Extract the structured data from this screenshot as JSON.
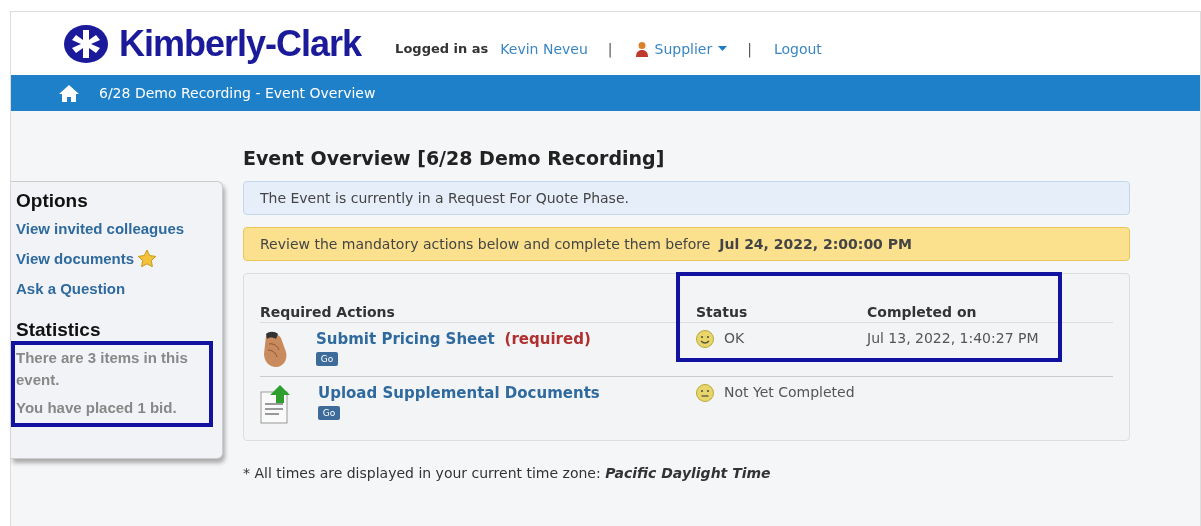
{
  "header": {
    "logo_text": "Kimberly-Clark",
    "logged_in_label": "Logged in as",
    "user": "Kevin Neveu",
    "separator_1": "|",
    "role": "Supplier",
    "separator_2": "|",
    "logout": "Logout"
  },
  "breadcrumb": {
    "text": "6/28 Demo Recording - Event Overview"
  },
  "sidebar": {
    "options_title": "Options",
    "links": [
      {
        "label": "View invited colleagues",
        "kind": "plain"
      },
      {
        "label": "View documents",
        "kind": "starred"
      },
      {
        "label": "Ask a Question",
        "kind": "plain"
      }
    ],
    "statistics_title": "Statistics",
    "statistics": [
      "There are 3 items in this event.",
      "You have placed 1 bid."
    ]
  },
  "title": "Event Overview [6/28 Demo Recording]",
  "phase_notice": "The Event is currently in a Request For Quote Phase.",
  "deadline_notice": {
    "text": "Review the mandatory actions below and complete them before",
    "deadline": "Jul 24, 2022, 2:00:00 PM"
  },
  "table": {
    "columns": [
      "Required Actions",
      "Status",
      "Completed on"
    ],
    "rows": [
      {
        "kind": "pricing",
        "action": "Submit Pricing Sheet",
        "required_label": "(required)",
        "button": "Go",
        "status": {
          "kind": "ok",
          "text": "OK"
        },
        "completed_on": "Jul 13, 2022, 1:40:27 PM"
      },
      {
        "kind": "upload",
        "action": "Upload Supplemental Documents",
        "button": "Go",
        "status": {
          "kind": "pending",
          "text": "Not Yet Completed"
        }
      }
    ]
  },
  "footnote": {
    "text": "* All times are displayed in your current time zone:",
    "zone": "Pacific Daylight Time"
  }
}
